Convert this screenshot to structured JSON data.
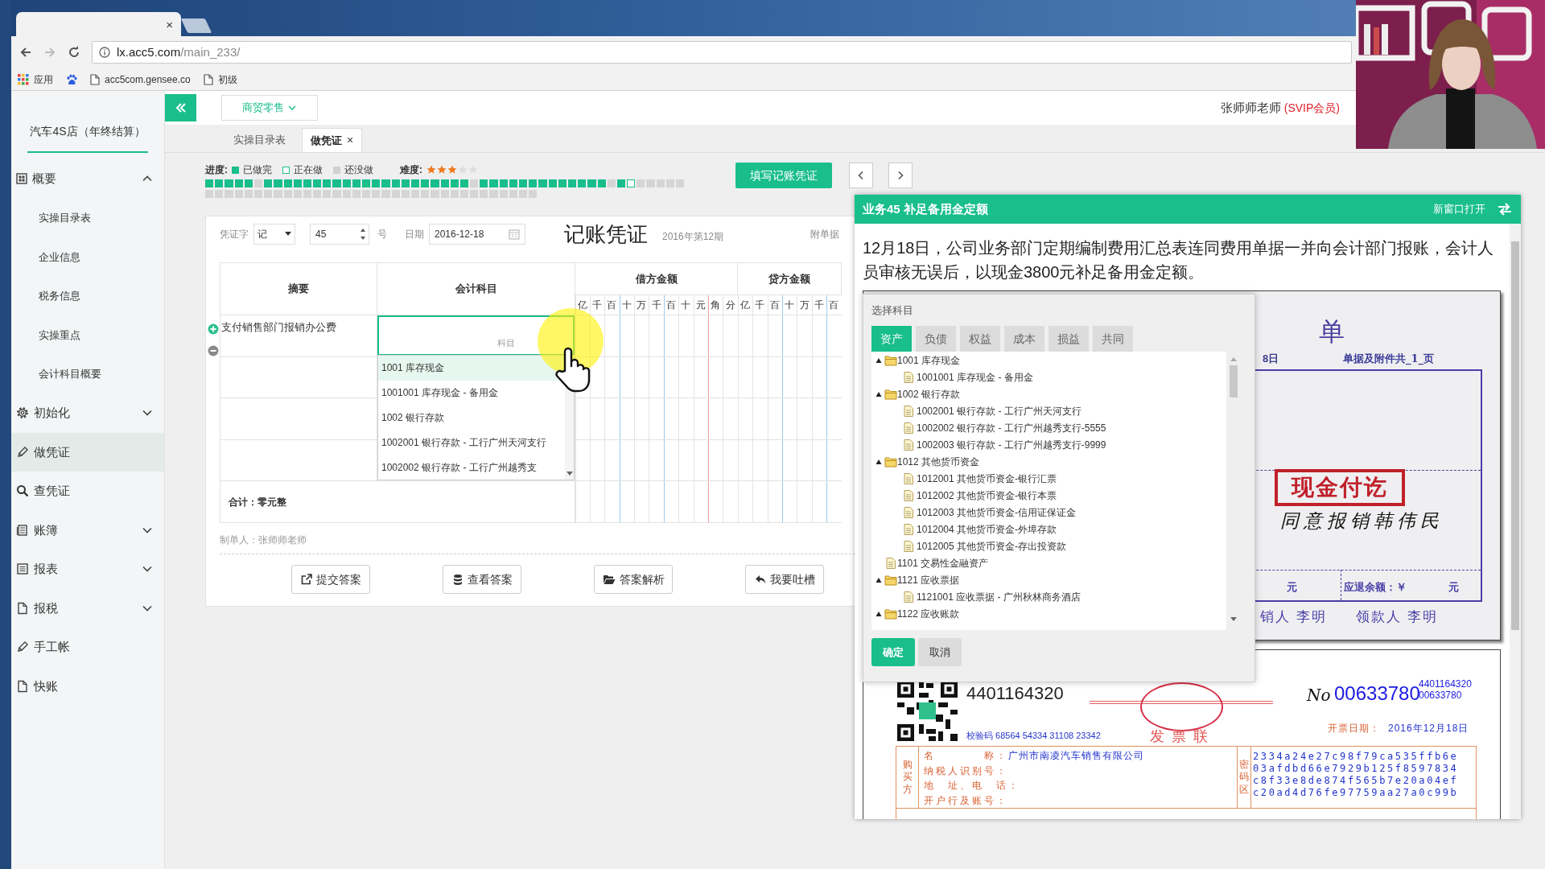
{
  "browser": {
    "tab_close": "×",
    "url_host": "lx.acc5.com",
    "url_path": "/main_233/",
    "bookmarks": [
      {
        "kind": "apps",
        "label": "应用"
      },
      {
        "kind": "paw"
      },
      {
        "kind": "page",
        "label": "acc5com.gensee.co"
      },
      {
        "kind": "page",
        "label": "初级"
      }
    ]
  },
  "sidebar": {
    "company": "汽车4S店（年终结算）",
    "items": [
      {
        "label": "概要",
        "expanded": true,
        "selected": false,
        "children": [
          {
            "label": "实操目录表",
            "selected": false
          },
          {
            "label": "企业信息",
            "selected": false
          },
          {
            "label": "税务信息",
            "selected": false
          },
          {
            "label": "实操重点",
            "selected": false
          },
          {
            "label": "会计科目概要",
            "selected": false
          }
        ]
      },
      {
        "label": "初始化",
        "expanded": false,
        "selected": false
      },
      {
        "label": "做凭证",
        "selected": true
      },
      {
        "label": "查凭证",
        "selected": false
      },
      {
        "label": "账簿",
        "expanded": false,
        "selected": false
      },
      {
        "label": "报表",
        "expanded": false,
        "selected": false
      },
      {
        "label": "报税",
        "expanded": false,
        "selected": false
      },
      {
        "label": "手工帐",
        "selected": false
      },
      {
        "label": "快账",
        "selected": false
      }
    ]
  },
  "topbar": {
    "industry": "商贸零售",
    "user": "张师师老师",
    "membership": "(SVIP会员)"
  },
  "tabs": [
    {
      "label": "实操目录表",
      "selected": false
    },
    {
      "label": "做凭证",
      "selected": true,
      "close": "×"
    }
  ],
  "progress": {
    "label": "进度:",
    "legend": [
      {
        "label": "已做完"
      },
      {
        "label": "正在做"
      },
      {
        "label": "还没做"
      }
    ],
    "difficulty_label": "难度:",
    "stars": 3,
    "cells": [
      {
        "done": true,
        "current": false
      },
      {
        "done": true,
        "current": false
      },
      {
        "done": true,
        "current": false
      },
      {
        "done": true,
        "current": false
      },
      {
        "done": true,
        "current": false
      },
      {
        "done": false,
        "current": false
      },
      {
        "done": true,
        "current": false
      },
      {
        "done": true,
        "current": false
      },
      {
        "done": true,
        "current": false
      },
      {
        "done": true,
        "current": false
      },
      {
        "done": true,
        "current": false
      },
      {
        "done": true,
        "current": false
      },
      {
        "done": true,
        "current": false
      },
      {
        "done": true,
        "current": false
      },
      {
        "done": true,
        "current": false
      },
      {
        "done": true,
        "current": false
      },
      {
        "done": true,
        "current": false
      },
      {
        "done": true,
        "current": false
      },
      {
        "done": true,
        "current": false
      },
      {
        "done": true,
        "current": false
      },
      {
        "done": true,
        "current": false
      },
      {
        "done": true,
        "current": false
      },
      {
        "done": true,
        "current": false
      },
      {
        "done": true,
        "current": false
      },
      {
        "done": true,
        "current": false
      },
      {
        "done": true,
        "current": false
      },
      {
        "done": true,
        "current": false
      },
      {
        "done": false,
        "current": false
      },
      {
        "done": true,
        "current": false
      },
      {
        "done": true,
        "current": false
      },
      {
        "done": true,
        "current": false
      },
      {
        "done": true,
        "current": false
      },
      {
        "done": true,
        "current": false
      },
      {
        "done": true,
        "current": false
      },
      {
        "done": true,
        "current": false
      },
      {
        "done": true,
        "current": false
      },
      {
        "done": true,
        "current": false
      },
      {
        "done": true,
        "current": false
      },
      {
        "done": true,
        "current": false
      },
      {
        "done": true,
        "current": false
      },
      {
        "done": true,
        "current": false
      },
      {
        "done": false,
        "current": false
      },
      {
        "done": true,
        "current": false
      },
      {
        "done": false,
        "current": true
      },
      {
        "done": false,
        "current": false
      },
      {
        "done": false,
        "current": false
      },
      {
        "done": false,
        "current": false
      },
      {
        "done": false,
        "current": false
      },
      {
        "done": false,
        "current": false
      },
      {
        "done": false,
        "current": false
      },
      {
        "done": false,
        "current": false
      },
      {
        "done": false,
        "current": false
      },
      {
        "done": false,
        "current": false
      },
      {
        "done": false,
        "current": false
      },
      {
        "done": false,
        "current": false
      },
      {
        "done": false,
        "current": false
      },
      {
        "done": false,
        "current": false
      },
      {
        "done": false,
        "current": false
      },
      {
        "done": false,
        "current": false
      },
      {
        "done": false,
        "current": false
      },
      {
        "done": false,
        "current": false
      },
      {
        "done": false,
        "current": false
      },
      {
        "done": false,
        "current": false
      },
      {
        "done": false,
        "current": false
      },
      {
        "done": false,
        "current": false
      },
      {
        "done": false,
        "current": false
      },
      {
        "done": false,
        "current": false
      },
      {
        "done": false,
        "current": false
      },
      {
        "done": false,
        "current": false
      },
      {
        "done": false,
        "current": false
      },
      {
        "done": false,
        "current": false
      },
      {
        "done": false,
        "current": false
      },
      {
        "done": false,
        "current": false
      },
      {
        "done": false,
        "current": false
      },
      {
        "done": false,
        "current": false
      },
      {
        "done": false,
        "current": false
      },
      {
        "done": false,
        "current": false
      },
      {
        "done": false,
        "current": false
      },
      {
        "done": false,
        "current": false
      },
      {
        "done": false,
        "current": false
      },
      {
        "done": false,
        "current": false
      },
      {
        "done": false,
        "current": false
      },
      {
        "done": false,
        "current": false
      }
    ]
  },
  "fill_button": "填写记账凭证",
  "voucher": {
    "word_label": "凭证字",
    "word": "记",
    "number": "45",
    "number_suffix": "号",
    "date_label": "日期",
    "date": "2016-12-18",
    "title": "记账凭证",
    "period": "2016年第12期",
    "attachments_label": "附单据",
    "columns": {
      "summary": "摘要",
      "subject": "会计科目",
      "debit": "借方金额",
      "credit": "贷方金额",
      "debit_digits": [
        "亿",
        "千",
        "百",
        "十",
        "万",
        "千",
        "百",
        "十",
        "元",
        "角",
        "分"
      ],
      "credit_digits": [
        "亿",
        "千",
        "百",
        "十",
        "万",
        "千",
        "百"
      ]
    },
    "rows": [
      {
        "active": true,
        "summary": "支付销售部门报销办公费",
        "placeholder": "科目"
      },
      {
        "active": false
      },
      {
        "active": false
      },
      {
        "active": false
      }
    ],
    "dropdown": [
      {
        "label": "1001 库存现金",
        "selected": true
      },
      {
        "label": "1001001 库存现金 - 备用金",
        "selected": false
      },
      {
        "label": "1002 银行存款",
        "selected": false
      },
      {
        "label": "1002001 银行存款 - 工行广州天河支行",
        "selected": false
      },
      {
        "label": "1002002 银行存款 - 工行广州越秀支",
        "selected": false
      }
    ],
    "total": "合计：零元整",
    "maker": "制单人：张师师老师"
  },
  "actions": [
    {
      "label": "提交答案"
    },
    {
      "label": "查看答案"
    },
    {
      "label": "答案解析"
    },
    {
      "label": "我要吐槽"
    }
  ],
  "task_panel": {
    "title": "业务45 补足备用金定额",
    "open_new": "新窗口打开",
    "description": "12月18日，公司业务部门定期编制费用汇总表连同费用单据一并向会计部门报账，会计人员审核无误后，以现金3800元补足备用金定额。"
  },
  "subject_dialog": {
    "title": "选择科目",
    "tabs": [
      {
        "label": "资产",
        "selected": true
      },
      {
        "label": "负债",
        "selected": false
      },
      {
        "label": "权益",
        "selected": false
      },
      {
        "label": "成本",
        "selected": false
      },
      {
        "label": "损益",
        "selected": false
      },
      {
        "label": "共同",
        "selected": false
      }
    ],
    "tree": [
      {
        "label": "1001 库存现金",
        "expanded": true,
        "children": [
          {
            "label": "1001001 库存现金 - 备用金"
          }
        ]
      },
      {
        "label": "1002 银行存款",
        "expanded": true,
        "children": [
          {
            "label": "1002001 银行存款 - 工行广州天河支行"
          },
          {
            "label": "1002002 银行存款 - 工行广州越秀支行-5555"
          },
          {
            "label": "1002003 银行存款 - 工行广州越秀支行-9999"
          }
        ]
      },
      {
        "label": "1012 其他货币资金",
        "expanded": true,
        "children": [
          {
            "label": "1012001 其他货币资金-银行汇票"
          },
          {
            "label": "1012002 其他货币资金-银行本票"
          },
          {
            "label": "1012003 其他货币资金-信用证保证金"
          },
          {
            "label": "1012004 其他货币资金-外埠存款"
          },
          {
            "label": "1012005 其他货币资金-存出投资款"
          }
        ]
      },
      {
        "label": "1101 交易性金融资产"
      },
      {
        "label": "1121 应收票据",
        "expanded": true,
        "children": [
          {
            "label": "1121001 应收票据 - 广州秋林商务酒店"
          }
        ]
      },
      {
        "label": "1122 应收账款",
        "expanded": true
      }
    ],
    "confirm": "确定",
    "cancel": "取消"
  },
  "reimbursement_form": {
    "title_fragment": "单",
    "date_fragment": "8日",
    "pages_note": "单据及附件共_1_页",
    "stamp": "现金付讫",
    "approval": "同意报销韩伟民",
    "amount_unit": "元",
    "refund_label": "应退余额：￥",
    "refund_unit": "元",
    "claimant": "销人 李明",
    "payee": "领款人 李明"
  },
  "invoice": {
    "code": "4401164320",
    "check_code": "校验码 68564 54334 31108 23342",
    "copy": "发 票 联",
    "no_label": "No",
    "number": "00633780",
    "code_small": "4401164320",
    "number_small": "00633780",
    "date_label": "开票日期：",
    "date": "2016年12月18日",
    "buyer_label": "购买方",
    "fields": [
      {
        "label": "名　　　　称：",
        "value": "广州市南凌汽车销售有限公司"
      },
      {
        "label": "纳税人识别号："
      },
      {
        "label": "地　址、电　话："
      },
      {
        "label": "开户行及账号："
      }
    ],
    "cipher_label": "密码区",
    "cipher": [
      "2334a24e27c98f79ca535ffb6e",
      "03afdbd66e7929b125f8597834",
      "c8f33e8de874f565b7e20a04ef",
      "c20ad4d76fe97759aa27a0c99b"
    ]
  }
}
